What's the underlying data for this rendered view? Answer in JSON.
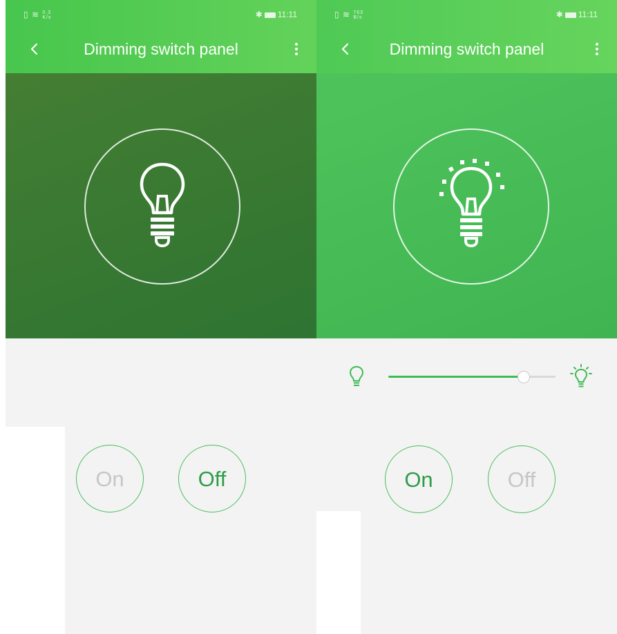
{
  "colors": {
    "accent": "#3dba55",
    "header_light": "#63d25a",
    "header_dark": "#2e7432",
    "page_bg": "#f3f3f3"
  },
  "screens": [
    {
      "status": {
        "left_icons": "sim wifi",
        "speed_value": "0.3",
        "speed_unit": "K/s",
        "time": "11:11"
      },
      "title": "Dimming switch panel",
      "back_icon": "chevron-left-icon",
      "menu_icon": "more-vertical-icon",
      "light_state": "off",
      "on_label": "On",
      "off_label": "Off",
      "active_button": "off"
    },
    {
      "status": {
        "left_icons": "sim wifi",
        "speed_value": "763",
        "speed_unit": "B/s",
        "time": "11:11"
      },
      "title": "Dimming switch panel",
      "back_icon": "chevron-left-icon",
      "menu_icon": "more-vertical-icon",
      "light_state": "on",
      "brightness": 0.81,
      "brightness_min_icon": "dim-bulb-icon",
      "brightness_max_icon": "bright-bulb-icon",
      "on_label": "On",
      "off_label": "Off",
      "active_button": "on"
    }
  ]
}
